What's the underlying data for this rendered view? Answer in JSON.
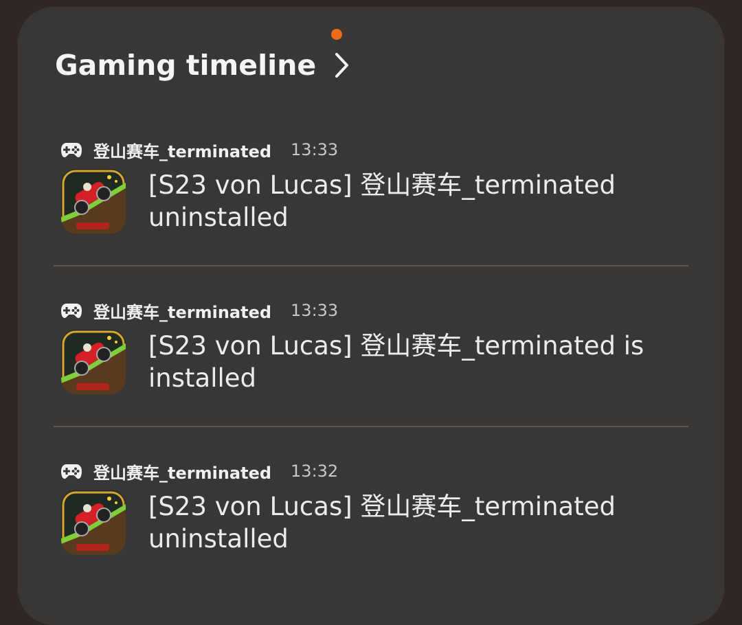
{
  "header": {
    "title": "Gaming timeline"
  },
  "colors": {
    "notification_dot": "#ee6b1c",
    "card_background": "#393735",
    "page_background": "#2e2724"
  },
  "icons": {
    "chevron": "chevron-right-icon",
    "gamepad": "gamepad-icon",
    "app": "hill-climb-racing-app-icon"
  },
  "entries": [
    {
      "app_name": "登山赛车_terminated",
      "time": "13:33",
      "message": "[S23 von Lucas] 登山赛车_terminated uninstalled"
    },
    {
      "app_name": "登山赛车_terminated",
      "time": "13:33",
      "message": "[S23 von Lucas] 登山赛车_terminated is installed"
    },
    {
      "app_name": "登山赛车_terminated",
      "time": "13:32",
      "message": "[S23 von Lucas] 登山赛车_terminated uninstalled"
    }
  ]
}
